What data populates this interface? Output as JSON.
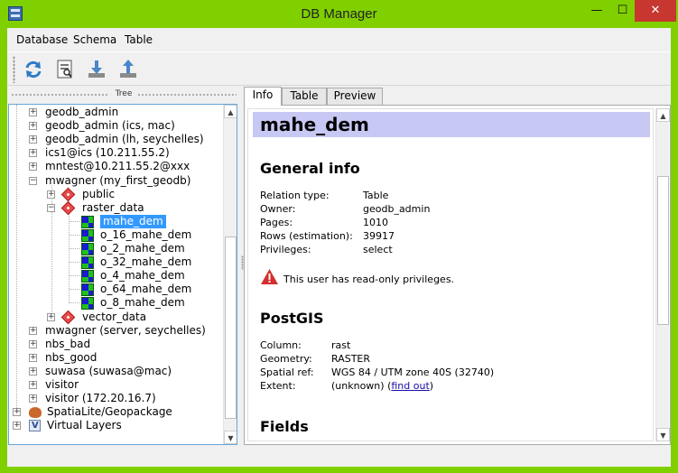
{
  "window": {
    "title": "DB Manager",
    "minimize": "—",
    "maximize": "☐",
    "close": "✕"
  },
  "menu": {
    "items": [
      "Database",
      "Schema",
      "Table"
    ]
  },
  "toolbar": {
    "buttons": [
      "refresh-icon",
      "sql-window-icon",
      "import-layer-icon",
      "export-layer-icon"
    ]
  },
  "tree": {
    "title": "Tree",
    "nodes": [
      {
        "label": "geodb_admin",
        "icon": "db"
      },
      {
        "label": "geodb_admin (ics, mac)",
        "icon": "db"
      },
      {
        "label": "geodb_admin (lh, seychelles)",
        "icon": "db"
      },
      {
        "label": "ics1@ics (10.211.55.2)",
        "icon": "db"
      },
      {
        "label": "mntest@10.211.55.2@xxx",
        "icon": "db"
      },
      {
        "label": "mwagner (my_first_geodb)",
        "icon": "db"
      },
      {
        "label": "public",
        "icon": "schema"
      },
      {
        "label": "raster_data",
        "icon": "schema"
      },
      {
        "label": "mahe_dem",
        "icon": "raster"
      },
      {
        "label": "o_16_mahe_dem",
        "icon": "raster"
      },
      {
        "label": "o_2_mahe_dem",
        "icon": "raster"
      },
      {
        "label": "o_32_mahe_dem",
        "icon": "raster"
      },
      {
        "label": "o_4_mahe_dem",
        "icon": "raster"
      },
      {
        "label": "o_64_mahe_dem",
        "icon": "raster"
      },
      {
        "label": "o_8_mahe_dem",
        "icon": "raster"
      },
      {
        "label": "vector_data",
        "icon": "schema"
      },
      {
        "label": "mwagner (server, seychelles)",
        "icon": "db"
      },
      {
        "label": "nbs_bad",
        "icon": "db"
      },
      {
        "label": "nbs_good",
        "icon": "db"
      },
      {
        "label": "suwasa (suwasa@mac)",
        "icon": "db"
      },
      {
        "label": "visitor",
        "icon": "db"
      },
      {
        "label": "visitor (172.20.16.7)",
        "icon": "db"
      },
      {
        "label": "SpatiaLite/Geopackage",
        "icon": "spatialite"
      },
      {
        "label": "Virtual Layers",
        "icon": "virtual"
      }
    ],
    "selected": "mahe_dem"
  },
  "tabs": [
    "Info",
    "Table",
    "Preview"
  ],
  "active_tab": "Info",
  "info": {
    "title": "mahe_dem",
    "general_heading": "General info",
    "general": [
      {
        "key": "Relation type:",
        "value": "Table"
      },
      {
        "key": "Owner:",
        "value": "geodb_admin"
      },
      {
        "key": "Pages:",
        "value": "1010"
      },
      {
        "key": "Rows (estimation):",
        "value": "39917"
      },
      {
        "key": "Privileges:",
        "value": "select"
      }
    ],
    "warning": "This user has read-only privileges.",
    "postgis_heading": "PostGIS",
    "postgis": [
      {
        "key": "Column:",
        "value": "rast"
      },
      {
        "key": "Geometry:",
        "value": "RASTER"
      },
      {
        "key": "Spatial ref:",
        "value": "WGS 84 / UTM zone 40S (32740)"
      },
      {
        "key": "Extent:",
        "value": "(unknown)"
      }
    ],
    "find_out_label": "find out",
    "fields_heading": "Fields"
  },
  "colors": {
    "window_frame": "#80d000",
    "selection": "#3399ff",
    "header_band": "#c8c8f4",
    "close_button": "#c7372f"
  }
}
